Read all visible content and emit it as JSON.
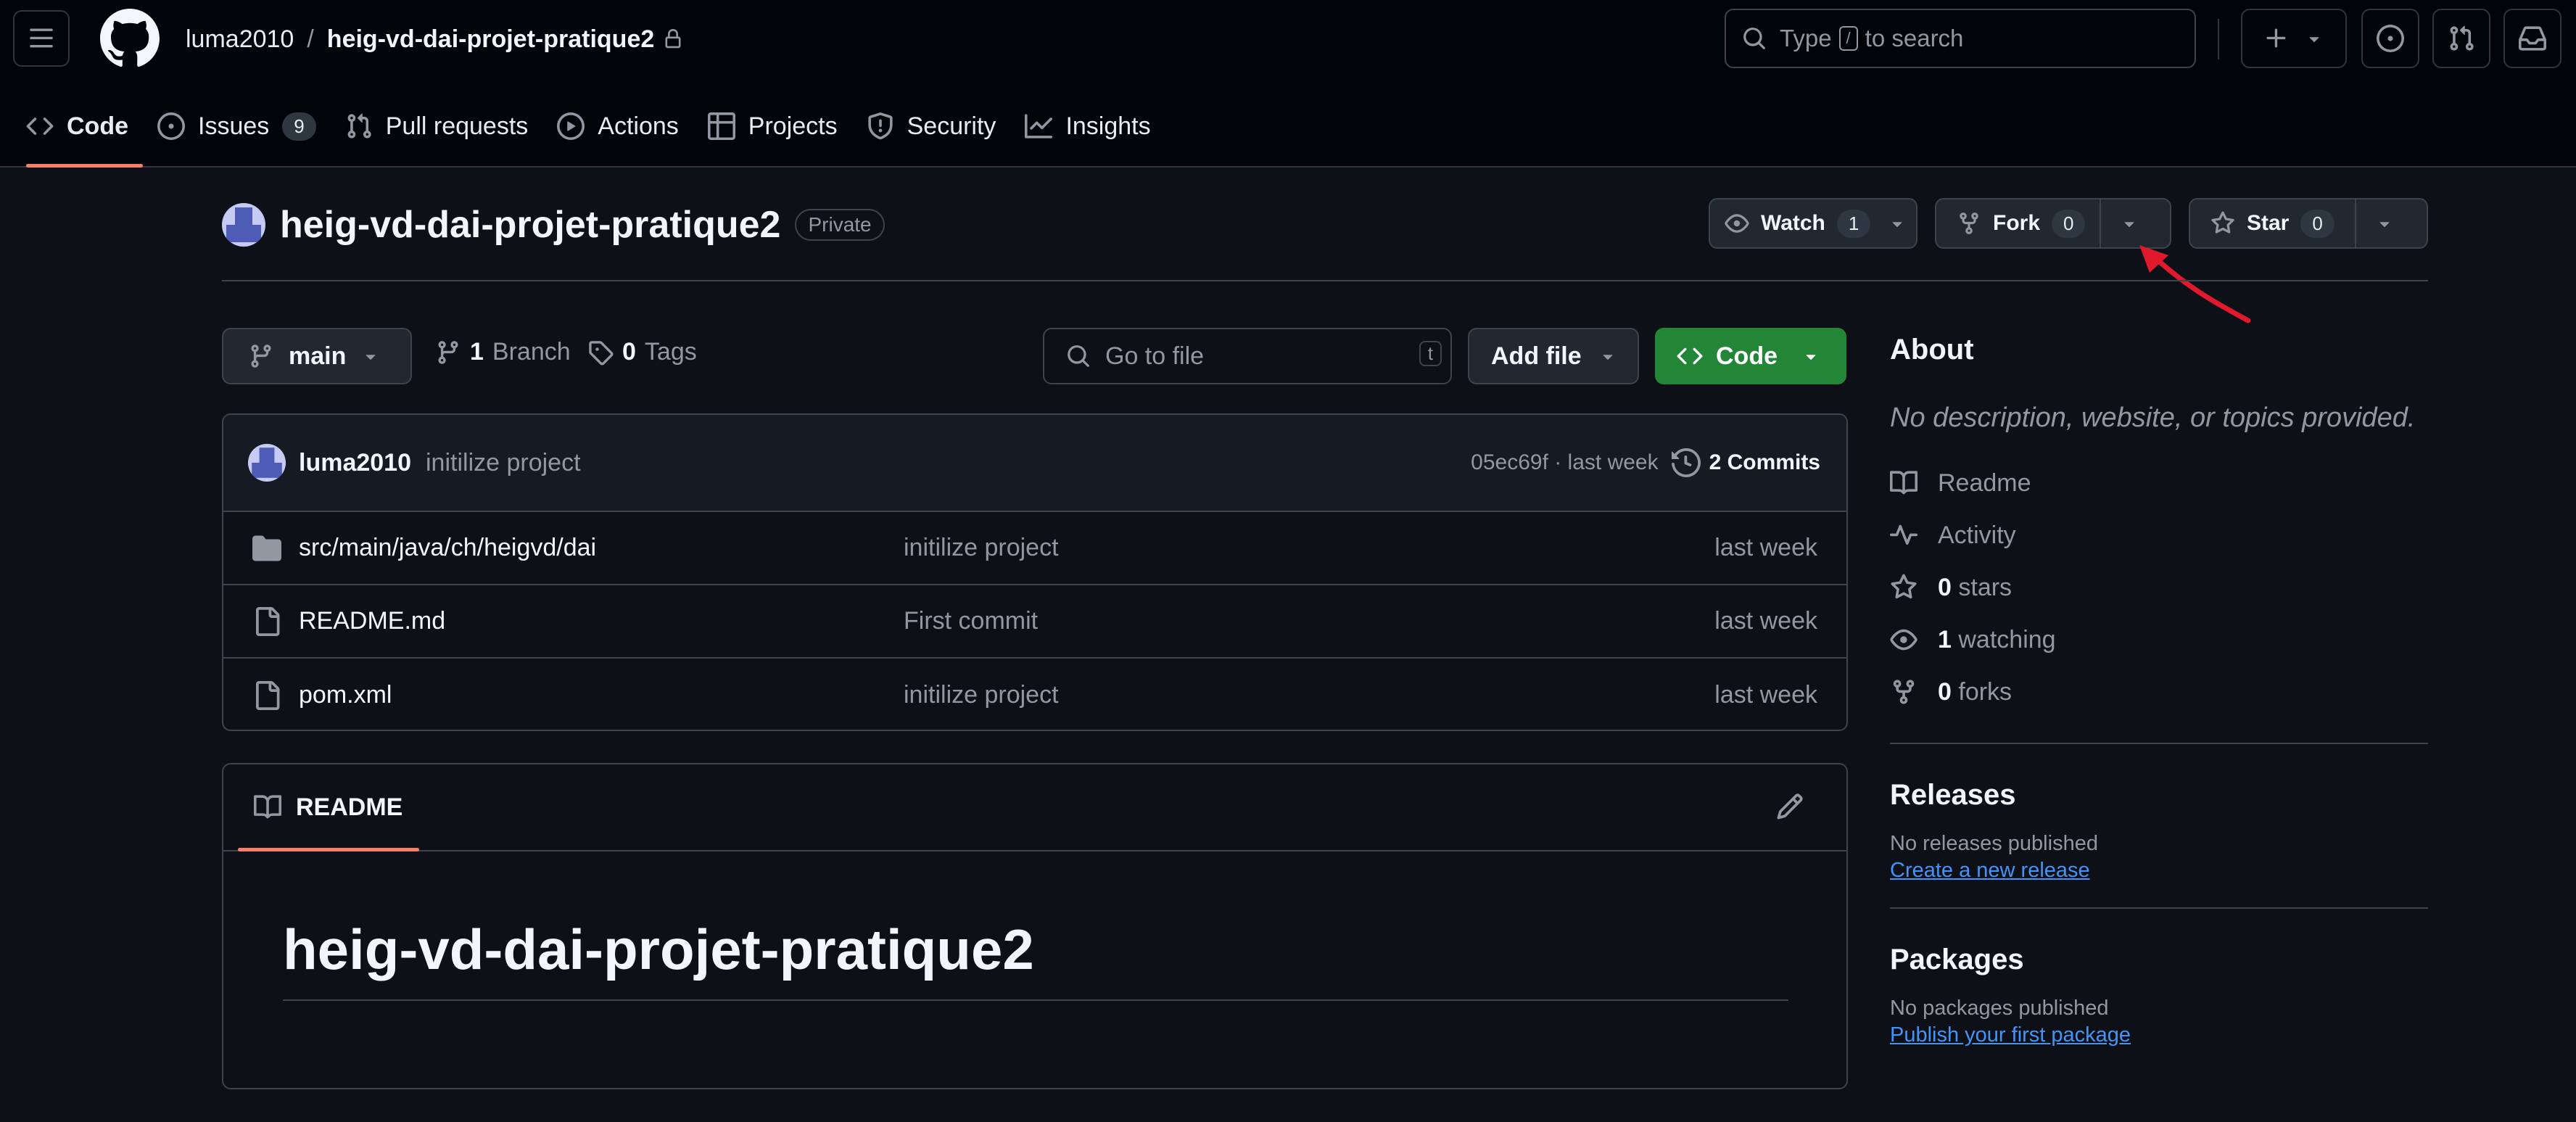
{
  "header": {
    "owner": "luma2010",
    "separator": "/",
    "repo": "heig-vd-dai-projet-pratique2",
    "search": {
      "prefix": "Type",
      "key": "/",
      "suffix": "to search"
    }
  },
  "nav": {
    "items": [
      {
        "label": "Code",
        "icon": "code-icon"
      },
      {
        "label": "Issues",
        "icon": "issue-opened-icon",
        "count": "9"
      },
      {
        "label": "Pull requests",
        "icon": "git-pull-request-icon"
      },
      {
        "label": "Actions",
        "icon": "play-icon"
      },
      {
        "label": "Projects",
        "icon": "table-icon"
      },
      {
        "label": "Security",
        "icon": "shield-icon"
      },
      {
        "label": "Insights",
        "icon": "graph-icon"
      }
    ],
    "active": "Code"
  },
  "repo": {
    "name": "heig-vd-dai-projet-pratique2",
    "visibility": "Private",
    "watch": {
      "label": "Watch",
      "count": "1"
    },
    "fork": {
      "label": "Fork",
      "count": "0"
    },
    "star": {
      "label": "Star",
      "count": "0"
    }
  },
  "filenav": {
    "branch": "main",
    "branches": {
      "count": "1",
      "label": "Branch"
    },
    "tags": {
      "count": "0",
      "label": "Tags"
    },
    "goto_placeholder": "Go to file",
    "goto_key": "t",
    "add_file": "Add file",
    "code": "Code"
  },
  "latest_commit": {
    "author": "luma2010",
    "message": "initilize project",
    "hash_time": "05ec69f · last week",
    "commits": "2 Commits"
  },
  "files": [
    {
      "type": "folder",
      "name": "src/main/java/ch/heigvd/dai",
      "message": "initilize project",
      "date": "last week"
    },
    {
      "type": "file",
      "name": "README.md",
      "message": "First commit",
      "date": "last week"
    },
    {
      "type": "file",
      "name": "pom.xml",
      "message": "initilize project",
      "date": "last week"
    }
  ],
  "readme": {
    "tab": "README",
    "title": "heig-vd-dai-projet-pratique2"
  },
  "about": {
    "heading": "About",
    "description": "No description, website, or topics provided.",
    "links": [
      {
        "icon": "book-icon",
        "label": "Readme"
      },
      {
        "icon": "pulse-icon",
        "label": "Activity"
      },
      {
        "icon": "star-icon",
        "count": "0",
        "label": "stars"
      },
      {
        "icon": "eye-icon",
        "count": "1",
        "label": "watching"
      },
      {
        "icon": "repo-forked-icon",
        "count": "0",
        "label": "forks"
      }
    ]
  },
  "releases": {
    "heading": "Releases",
    "empty": "No releases published",
    "link": "Create a new release"
  },
  "packages": {
    "heading": "Packages",
    "empty": "No packages published",
    "link": "Publish your first package"
  },
  "colors": {
    "background": "#0d1117",
    "header_bg": "#010409",
    "accent_underline": "#f78166",
    "code_button": "#238636",
    "link": "#4493f8",
    "annotation_arrow": "#e0192d"
  }
}
